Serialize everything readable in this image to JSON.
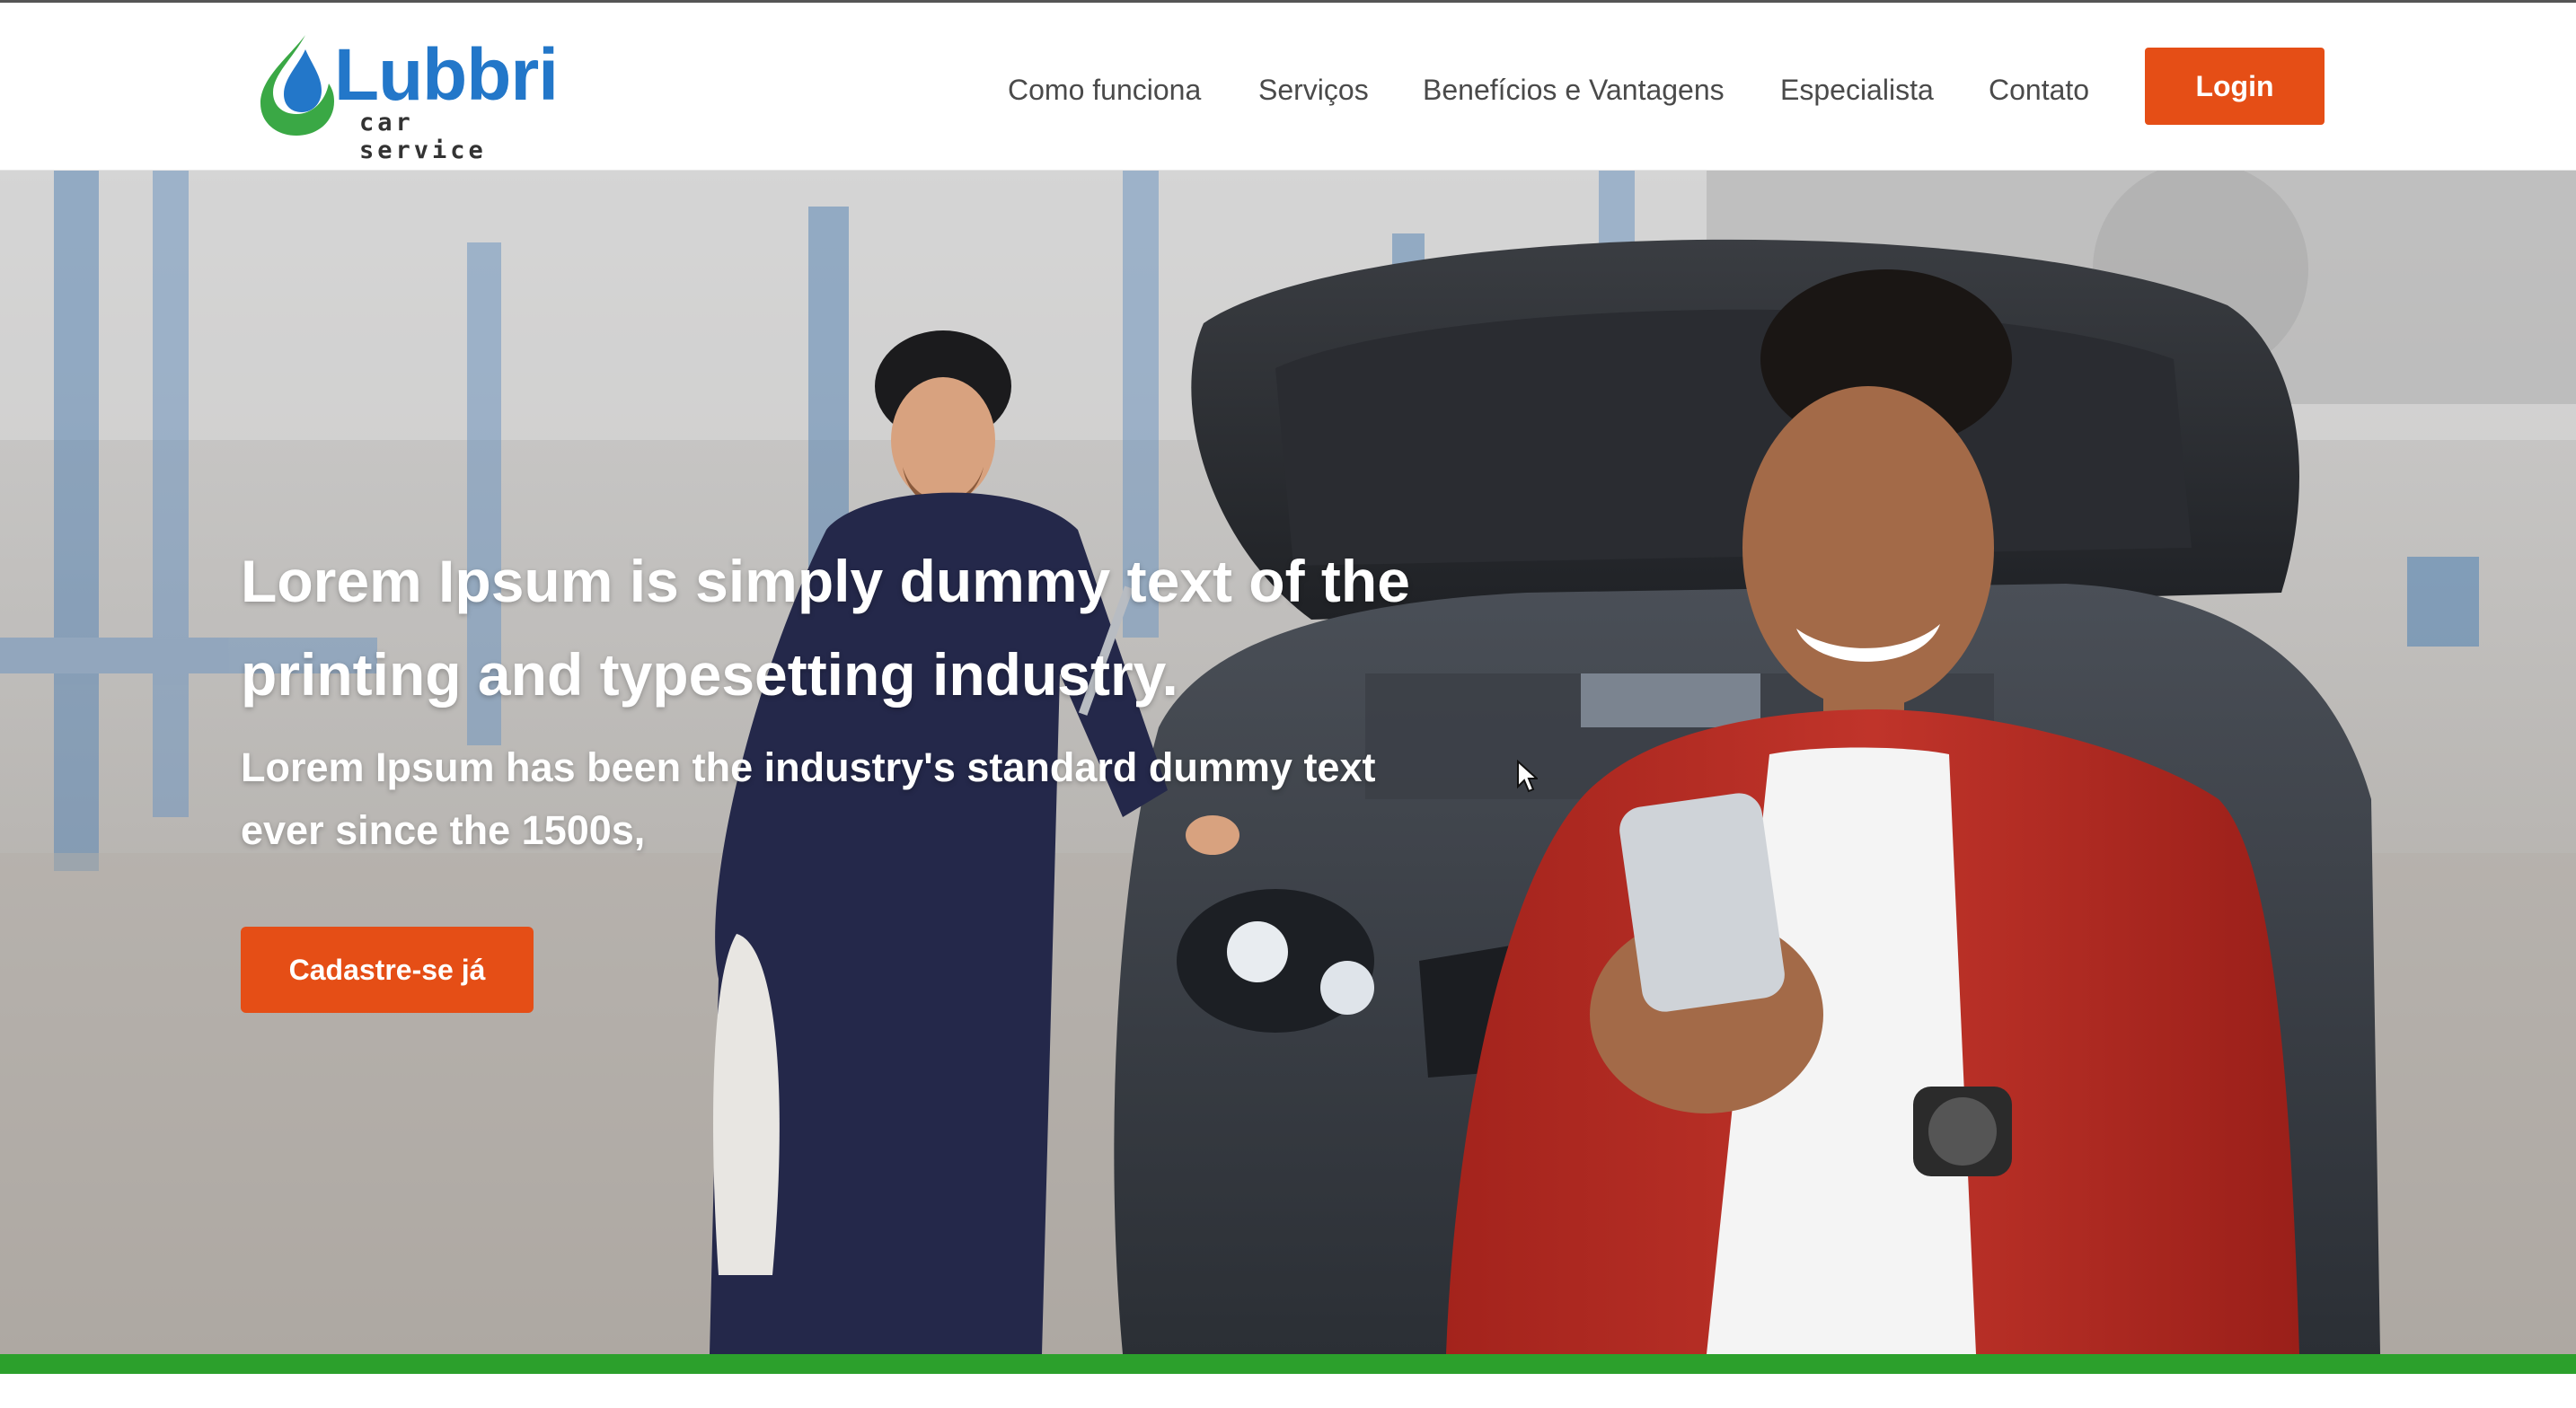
{
  "brand": {
    "name": "Lubbri",
    "tagline": "car service",
    "colors": {
      "drop_blue": "#2377c9",
      "drop_green": "#3aa845",
      "word_blue": "#2377c9"
    }
  },
  "nav": {
    "items": [
      {
        "label": "Como funciona"
      },
      {
        "label": "Serviços"
      },
      {
        "label": "Benefícios e Vantagens"
      },
      {
        "label": "Especialista"
      },
      {
        "label": "Contato"
      }
    ],
    "login_label": "Login"
  },
  "hero": {
    "title": "Lorem Ipsum is simply dummy text of the printing and typesetting industry.",
    "subtitle": "Lorem Ipsum has been the industry's standard dummy text ever since the 1500s,",
    "cta_label": "Cadastre-se já"
  },
  "colors": {
    "accent": "#e54e16",
    "footer_bar": "#2ca02c",
    "nav_text": "#4a4a4a"
  },
  "icons": {
    "logo": "water-drop-icon",
    "cursor": "mouse-pointer-icon"
  }
}
